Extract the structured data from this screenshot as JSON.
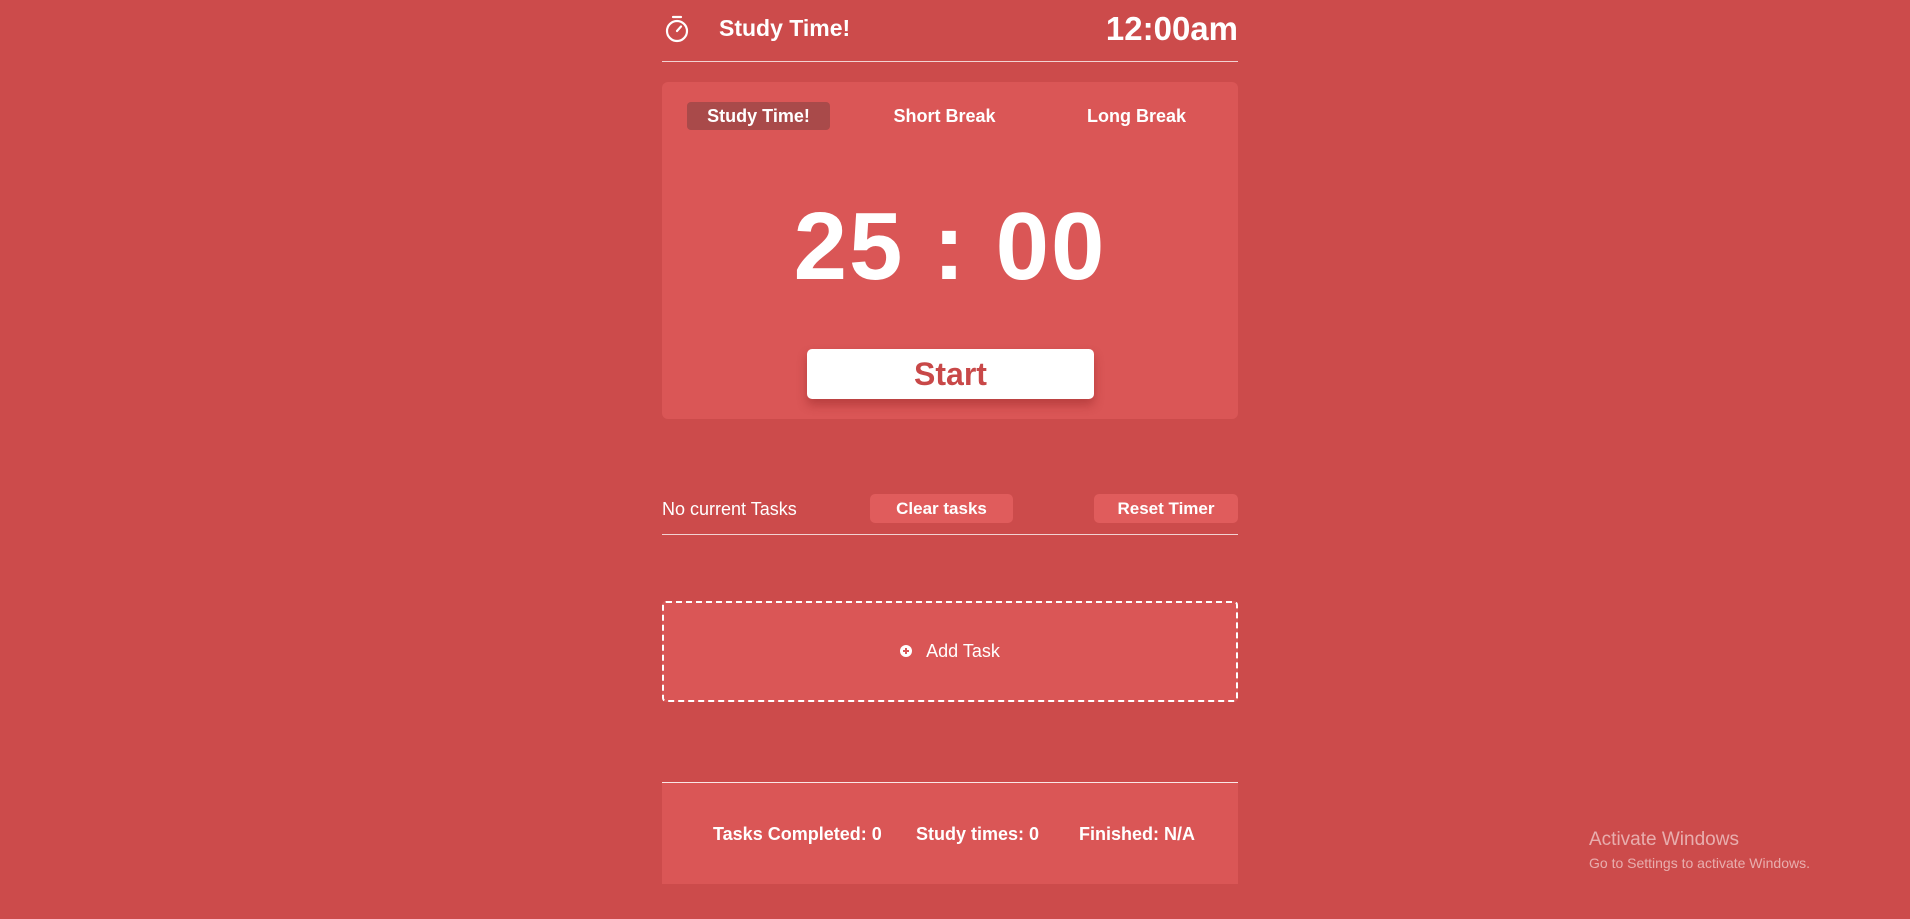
{
  "header": {
    "title": "Study Time!",
    "clock": "12:00am"
  },
  "timer": {
    "tabs": [
      {
        "label": "Study Time!",
        "active": true
      },
      {
        "label": "Short Break",
        "active": false
      },
      {
        "label": "Long Break",
        "active": false
      }
    ],
    "display": "25 : 00",
    "start_label": "Start"
  },
  "tasks": {
    "status": "No current Tasks",
    "clear_label": "Clear tasks",
    "reset_label": "Reset Timer",
    "add_label": "Add Task"
  },
  "footer": {
    "tasks_completed": "Tasks Completed: 0",
    "study_times": "Study times: 0",
    "finished": "Finished: N/A"
  },
  "watermark": {
    "title": "Activate Windows",
    "subtitle": "Go to Settings to activate Windows."
  },
  "icons": {
    "brand": "stopwatch-icon",
    "add": "plus-circle-icon"
  },
  "colors": {
    "background": "#cc4b4b",
    "card": "#da5656",
    "active_tab": "#a94a4a",
    "accent_text": "#c84848"
  }
}
